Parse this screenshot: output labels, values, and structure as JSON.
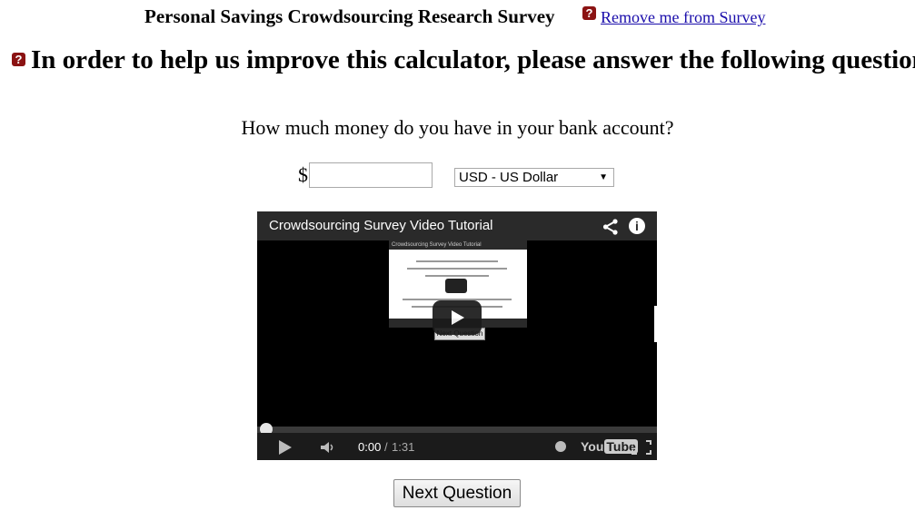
{
  "header": {
    "survey_title": "Personal Savings Crowdsourcing Research Survey",
    "remove_link": "Remove me from Survey",
    "help_icon": "question-mark-icon"
  },
  "main": {
    "heading": "In order to help us improve this calculator, please answer the following question:",
    "question": "How much money do you have in your bank account?",
    "currency_symbol": "$",
    "amount_value": "",
    "currency_selected": "USD - US Dollar"
  },
  "video": {
    "title": "Crowdsourcing Survey Video Tutorial",
    "thumb_title": "Crowdsourcing Survey Video Tutorial",
    "thumb_button": "Next Question",
    "time_current": "0:00",
    "time_separator": "/",
    "time_total": "1:31",
    "youtube_logo_a": "You",
    "youtube_logo_b": "Tube",
    "progress": 0
  },
  "footer": {
    "next_button": "Next Question"
  },
  "colors": {
    "help_badge": "#8b1313",
    "link": "#1a0dab",
    "video_bar": "#2a2a2a"
  }
}
